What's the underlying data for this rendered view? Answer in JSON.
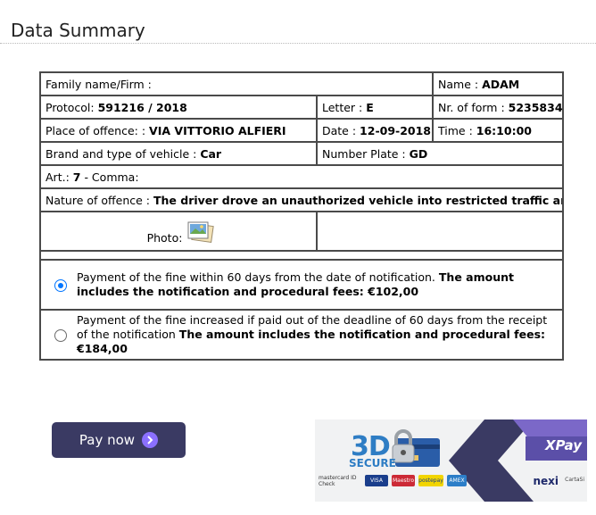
{
  "page": {
    "title": "Data Summary"
  },
  "summary": {
    "family_label": "Family name/Firm :",
    "family_value": "",
    "name_label": "Name :",
    "name_value": "ADAM",
    "protocol_label": "Protocol:",
    "protocol_value": "591216 / 2018",
    "letter_label": "Letter :",
    "letter_value": "E",
    "form_label": "Nr. of form :",
    "form_value": "5235834",
    "place_label": "Place of offence: :",
    "place_value": "VIA VITTORIO ALFIERI",
    "date_label": "Date :",
    "date_value": "12-09-2018",
    "time_label": "Time :",
    "time_value": "16:10:00",
    "vehicle_label": "Brand and type of vehicle :",
    "vehicle_value": "Car",
    "plate_label": "Number Plate :",
    "plate_value": "GD",
    "art_label": "Art.:",
    "art_value": "7",
    "comma_label": "- Comma:",
    "comma_value": "",
    "nature_label": "Nature of offence :",
    "nature_value": "The driver drove an unauthorized vehicle into restricted traffic area.",
    "photo_label": "Photo:"
  },
  "payment_options": [
    {
      "selected": true,
      "text": "Payment of the fine within 60 days from the date of notification.",
      "bold": "The amount includes the notification and procedural fees: €102,00"
    },
    {
      "selected": false,
      "text": "Payment of the fine increased if paid out of the deadline of 60 days from the receipt of the notification",
      "bold": "The amount includes the notification and procedural fees: €184,00"
    }
  ],
  "pay_button": {
    "label": "Pay now",
    "color": "#3a3a63",
    "accent": "#8b70ff"
  },
  "banner": {
    "brand_3d": "3D",
    "brand_secure": "SECURE",
    "xpay": "XPay",
    "nexi": "nexi",
    "nexi_sub": "CartaSi",
    "logos": [
      "mastercard ID Check",
      "VISA",
      "Maestro",
      "postepay",
      "AMEX"
    ],
    "colors": {
      "blue": "#2e7dc4",
      "purple": "#5b4fa8",
      "dark": "#3a3a63"
    }
  },
  "icons": {
    "photo": "photo-gallery-icon",
    "pay_arrow": "chevron-right-icon",
    "lock": "padlock-icon"
  }
}
